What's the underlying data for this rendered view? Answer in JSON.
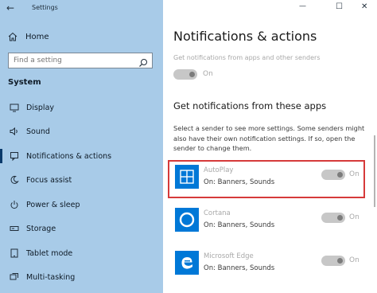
{
  "window": {
    "title": "Settings",
    "back_glyph": "←",
    "minimize_glyph": "—",
    "maximize_glyph": "☐",
    "close_glyph": "✕"
  },
  "sidebar": {
    "home_label": "Home",
    "search_placeholder": "Find a setting",
    "section_label": "System",
    "items": [
      {
        "label": "Display",
        "icon": "display-icon"
      },
      {
        "label": "Sound",
        "icon": "sound-icon"
      },
      {
        "label": "Notifications & actions",
        "icon": "notifications-icon",
        "active": true
      },
      {
        "label": "Focus assist",
        "icon": "moon-icon"
      },
      {
        "label": "Power & sleep",
        "icon": "power-icon"
      },
      {
        "label": "Storage",
        "icon": "storage-icon"
      },
      {
        "label": "Tablet mode",
        "icon": "tablet-icon"
      },
      {
        "label": "Multi-tasking",
        "icon": "multitasking-icon"
      }
    ]
  },
  "main": {
    "title": "Notifications & actions",
    "global_toggle": {
      "label": "Get notifications from apps and other senders",
      "state": "On"
    },
    "apps_heading": "Get notifications from these apps",
    "description": "Select a sender to see more settings. Some senders might also have their own notification settings. If so, open the sender to change them.",
    "apps": [
      {
        "name": "AutoPlay",
        "detail": "On: Banners, Sounds",
        "state": "On",
        "icon": "autoplay-icon",
        "highlighted": true
      },
      {
        "name": "Cortana",
        "detail": "On: Banners, Sounds",
        "state": "On",
        "icon": "cortana-icon"
      },
      {
        "name": "Microsoft Edge",
        "detail": "On: Banners, Sounds",
        "state": "On",
        "icon": "edge-icon"
      }
    ]
  },
  "colors": {
    "sidebar_bg": "#a8cbe8",
    "accent": "#0078d7",
    "highlight_border": "#d63a3a"
  }
}
